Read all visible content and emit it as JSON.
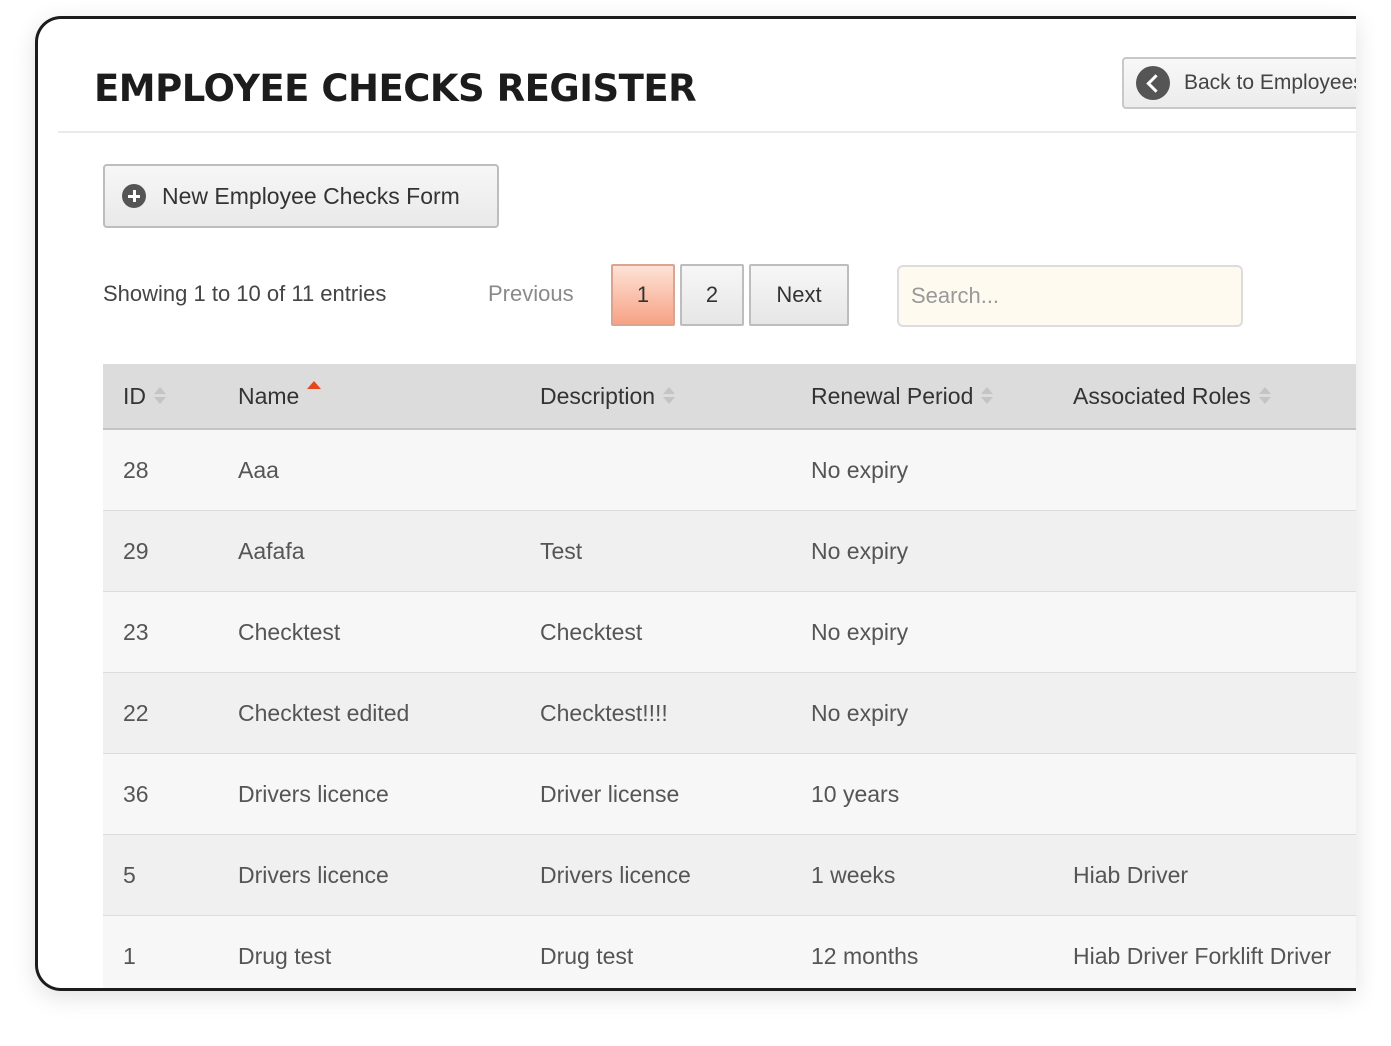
{
  "header": {
    "title": "EMPLOYEE CHECKS REGISTER",
    "back_button_label": "Back to Employees"
  },
  "toolbar": {
    "new_form_label": "New Employee Checks Form"
  },
  "pagination": {
    "info": "Showing 1 to 10 of 11 entries",
    "previous_label": "Previous",
    "pages": [
      "1",
      "2"
    ],
    "current_page": "1",
    "next_label": "Next"
  },
  "search": {
    "placeholder": "Search...",
    "value": ""
  },
  "table": {
    "columns": [
      "ID",
      "Name",
      "Description",
      "Renewal Period",
      "Associated Roles"
    ],
    "sorted_column": "Name",
    "sort_direction": "ascending",
    "rows": [
      [
        "28",
        "Aaa",
        "",
        "No expiry",
        ""
      ],
      [
        "29",
        "Aafafa",
        "Test",
        "No expiry",
        ""
      ],
      [
        "23",
        "Checktest",
        "Checktest",
        "No expiry",
        ""
      ],
      [
        "22",
        "Checktest edited",
        "Checktest!!!!",
        "No expiry",
        ""
      ],
      [
        "36",
        "Drivers licence",
        "Driver license",
        "10 years",
        ""
      ],
      [
        "5",
        "Drivers licence",
        "Drivers licence",
        "1 weeks",
        "Hiab Driver"
      ],
      [
        "1",
        "Drug test",
        "Drug test",
        "12 months",
        "Hiab Driver Forklift Driver"
      ]
    ]
  },
  "colors": {
    "accent_sort": "#e8451c",
    "active_page": "#f7a285",
    "header_bg": "#dcdcdc"
  },
  "icons": {
    "back": "chevron-left-circle-icon",
    "new": "plus-circle-icon"
  }
}
